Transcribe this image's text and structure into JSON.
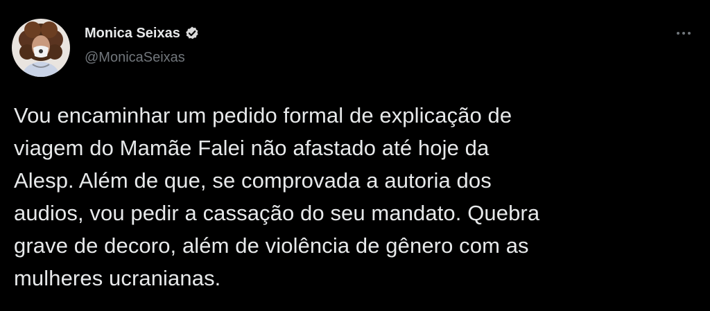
{
  "author": {
    "display_name": "Monica Seixas",
    "handle": "@MonicaSeixas",
    "verified": true,
    "avatar_icon": "profile-photo",
    "verified_icon": "verified-badge-icon"
  },
  "tweet": {
    "text_lines": [
      "Vou encaminhar um pedido formal de explicação de",
      "viagem do Mamãe Falei não afastado até hoje da",
      "Alesp. Além de que, se comprovada a autoria dos",
      "audios, vou pedir a cassação do seu mandato. Quebra",
      "grave de decoro, além de violência de gênero com as",
      "mulheres ucranianas."
    ]
  },
  "menu": {
    "more_icon": "more-horizontal-icon"
  },
  "colors": {
    "background": "#000000",
    "primary_text": "#e7e9ea",
    "secondary_text": "#71767b",
    "verified_badge": "#d9d9d9"
  }
}
